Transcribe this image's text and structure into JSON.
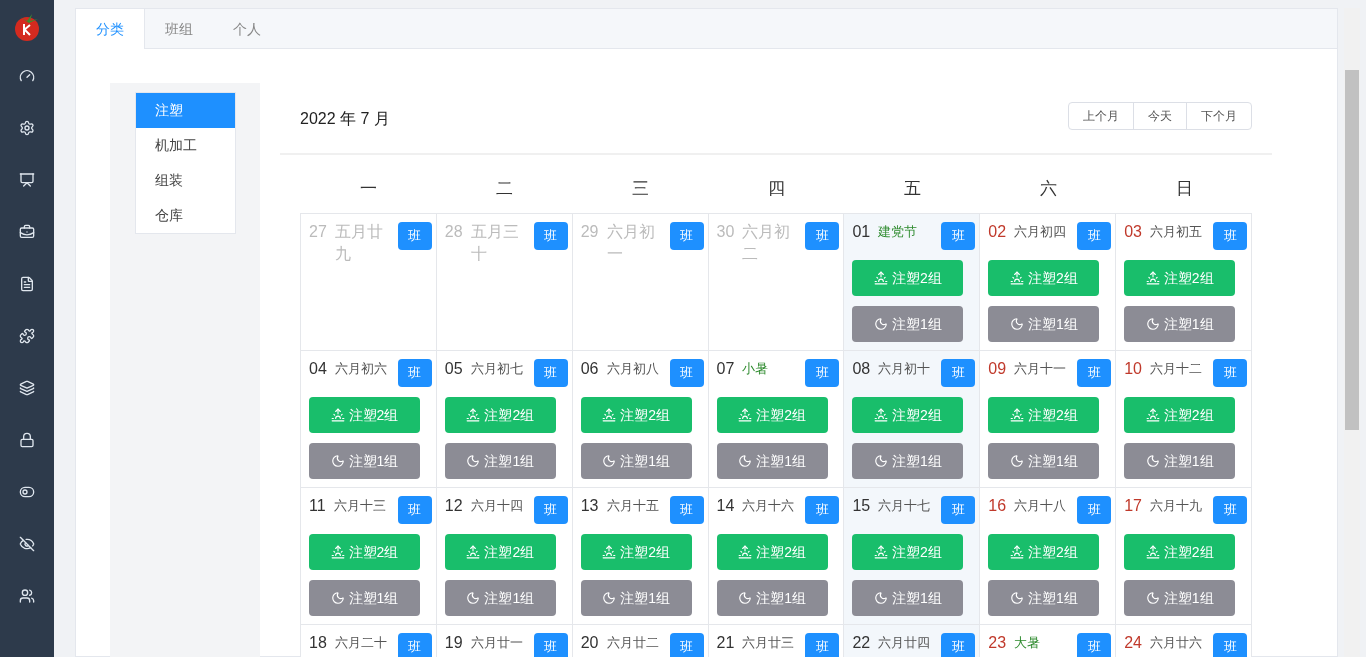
{
  "tabs": [
    {
      "label": "分类",
      "selected": true
    },
    {
      "label": "班组",
      "selected": false
    },
    {
      "label": "个人",
      "selected": false
    }
  ],
  "categories": [
    {
      "label": "注塑",
      "selected": true
    },
    {
      "label": "机加工",
      "selected": false
    },
    {
      "label": "组装",
      "selected": false
    },
    {
      "label": "仓库",
      "selected": false
    }
  ],
  "calendar": {
    "title": "2022 年 7 月",
    "nav_buttons": [
      "上个月",
      "今天",
      "下个月"
    ],
    "weekdays": [
      "一",
      "二",
      "三",
      "四",
      "五",
      "六",
      "日"
    ],
    "weeks": [
      [
        {
          "day": "27",
          "lunar": "五月廿九",
          "other_month": true,
          "weekend": false,
          "festival": false,
          "highlight": false,
          "badge": "班"
        },
        {
          "day": "28",
          "lunar": "五月三十",
          "other_month": true,
          "weekend": false,
          "festival": false,
          "highlight": false,
          "badge": "班"
        },
        {
          "day": "29",
          "lunar": "六月初一",
          "other_month": true,
          "weekend": false,
          "festival": false,
          "highlight": false,
          "badge": "班"
        },
        {
          "day": "30",
          "lunar": "六月初二",
          "other_month": true,
          "weekend": false,
          "festival": false,
          "highlight": false,
          "badge": "班"
        },
        {
          "day": "01",
          "lunar": "建党节",
          "other_month": false,
          "weekend": false,
          "festival": true,
          "highlight": true,
          "badge": "班",
          "shifts": [
            {
              "kind": "day",
              "label": "注塑2组"
            },
            {
              "kind": "night",
              "label": "注塑1组"
            }
          ]
        },
        {
          "day": "02",
          "lunar": "六月初四",
          "other_month": false,
          "weekend": true,
          "festival": false,
          "highlight": false,
          "badge": "班",
          "shifts": [
            {
              "kind": "day",
              "label": "注塑2组"
            },
            {
              "kind": "night",
              "label": "注塑1组"
            }
          ]
        },
        {
          "day": "03",
          "lunar": "六月初五",
          "other_month": false,
          "weekend": true,
          "festival": false,
          "highlight": false,
          "badge": "班",
          "shifts": [
            {
              "kind": "day",
              "label": "注塑2组"
            },
            {
              "kind": "night",
              "label": "注塑1组"
            }
          ]
        }
      ],
      [
        {
          "day": "04",
          "lunar": "六月初六",
          "other_month": false,
          "weekend": false,
          "festival": false,
          "highlight": false,
          "badge": "班",
          "shifts": [
            {
              "kind": "day",
              "label": "注塑2组"
            },
            {
              "kind": "night",
              "label": "注塑1组"
            }
          ]
        },
        {
          "day": "05",
          "lunar": "六月初七",
          "other_month": false,
          "weekend": false,
          "festival": false,
          "highlight": false,
          "badge": "班",
          "shifts": [
            {
              "kind": "day",
              "label": "注塑2组"
            },
            {
              "kind": "night",
              "label": "注塑1组"
            }
          ]
        },
        {
          "day": "06",
          "lunar": "六月初八",
          "other_month": false,
          "weekend": false,
          "festival": false,
          "highlight": false,
          "badge": "班",
          "shifts": [
            {
              "kind": "day",
              "label": "注塑2组"
            },
            {
              "kind": "night",
              "label": "注塑1组"
            }
          ]
        },
        {
          "day": "07",
          "lunar": "小暑",
          "other_month": false,
          "weekend": false,
          "festival": true,
          "highlight": false,
          "badge": "班",
          "shifts": [
            {
              "kind": "day",
              "label": "注塑2组"
            },
            {
              "kind": "night",
              "label": "注塑1组"
            }
          ]
        },
        {
          "day": "08",
          "lunar": "六月初十",
          "other_month": false,
          "weekend": false,
          "festival": false,
          "highlight": true,
          "badge": "班",
          "shifts": [
            {
              "kind": "day",
              "label": "注塑2组"
            },
            {
              "kind": "night",
              "label": "注塑1组"
            }
          ]
        },
        {
          "day": "09",
          "lunar": "六月十一",
          "other_month": false,
          "weekend": true,
          "festival": false,
          "highlight": false,
          "badge": "班",
          "shifts": [
            {
              "kind": "day",
              "label": "注塑2组"
            },
            {
              "kind": "night",
              "label": "注塑1组"
            }
          ]
        },
        {
          "day": "10",
          "lunar": "六月十二",
          "other_month": false,
          "weekend": true,
          "festival": false,
          "highlight": false,
          "badge": "班",
          "shifts": [
            {
              "kind": "day",
              "label": "注塑2组"
            },
            {
              "kind": "night",
              "label": "注塑1组"
            }
          ]
        }
      ],
      [
        {
          "day": "11",
          "lunar": "六月十三",
          "other_month": false,
          "weekend": false,
          "festival": false,
          "highlight": false,
          "badge": "班",
          "shifts": [
            {
              "kind": "day",
              "label": "注塑2组"
            },
            {
              "kind": "night",
              "label": "注塑1组"
            }
          ]
        },
        {
          "day": "12",
          "lunar": "六月十四",
          "other_month": false,
          "weekend": false,
          "festival": false,
          "highlight": false,
          "badge": "班",
          "shifts": [
            {
              "kind": "day",
              "label": "注塑2组"
            },
            {
              "kind": "night",
              "label": "注塑1组"
            }
          ]
        },
        {
          "day": "13",
          "lunar": "六月十五",
          "other_month": false,
          "weekend": false,
          "festival": false,
          "highlight": false,
          "badge": "班",
          "shifts": [
            {
              "kind": "day",
              "label": "注塑2组"
            },
            {
              "kind": "night",
              "label": "注塑1组"
            }
          ]
        },
        {
          "day": "14",
          "lunar": "六月十六",
          "other_month": false,
          "weekend": false,
          "festival": false,
          "highlight": false,
          "badge": "班",
          "shifts": [
            {
              "kind": "day",
              "label": "注塑2组"
            },
            {
              "kind": "night",
              "label": "注塑1组"
            }
          ]
        },
        {
          "day": "15",
          "lunar": "六月十七",
          "other_month": false,
          "weekend": false,
          "festival": false,
          "highlight": true,
          "badge": "班",
          "shifts": [
            {
              "kind": "day",
              "label": "注塑2组"
            },
            {
              "kind": "night",
              "label": "注塑1组"
            }
          ]
        },
        {
          "day": "16",
          "lunar": "六月十八",
          "other_month": false,
          "weekend": true,
          "festival": false,
          "highlight": false,
          "badge": "班",
          "shifts": [
            {
              "kind": "day",
              "label": "注塑2组"
            },
            {
              "kind": "night",
              "label": "注塑1组"
            }
          ]
        },
        {
          "day": "17",
          "lunar": "六月十九",
          "other_month": false,
          "weekend": true,
          "festival": false,
          "highlight": false,
          "badge": "班",
          "shifts": [
            {
              "kind": "day",
              "label": "注塑2组"
            },
            {
              "kind": "night",
              "label": "注塑1组"
            }
          ]
        }
      ],
      [
        {
          "day": "18",
          "lunar": "六月二十",
          "other_month": false,
          "weekend": false,
          "festival": false,
          "highlight": false,
          "badge": "班"
        },
        {
          "day": "19",
          "lunar": "六月廿一",
          "other_month": false,
          "weekend": false,
          "festival": false,
          "highlight": false,
          "badge": "班"
        },
        {
          "day": "20",
          "lunar": "六月廿二",
          "other_month": false,
          "weekend": false,
          "festival": false,
          "highlight": false,
          "badge": "班"
        },
        {
          "day": "21",
          "lunar": "六月廿三",
          "other_month": false,
          "weekend": false,
          "festival": false,
          "highlight": false,
          "badge": "班"
        },
        {
          "day": "22",
          "lunar": "六月廿四",
          "other_month": false,
          "weekend": false,
          "festival": false,
          "highlight": true,
          "badge": "班"
        },
        {
          "day": "23",
          "lunar": "大暑",
          "other_month": false,
          "weekend": true,
          "festival": true,
          "highlight": false,
          "badge": "班"
        },
        {
          "day": "24",
          "lunar": "六月廿六",
          "other_month": false,
          "weekend": true,
          "festival": false,
          "highlight": false,
          "badge": "班"
        }
      ]
    ]
  }
}
